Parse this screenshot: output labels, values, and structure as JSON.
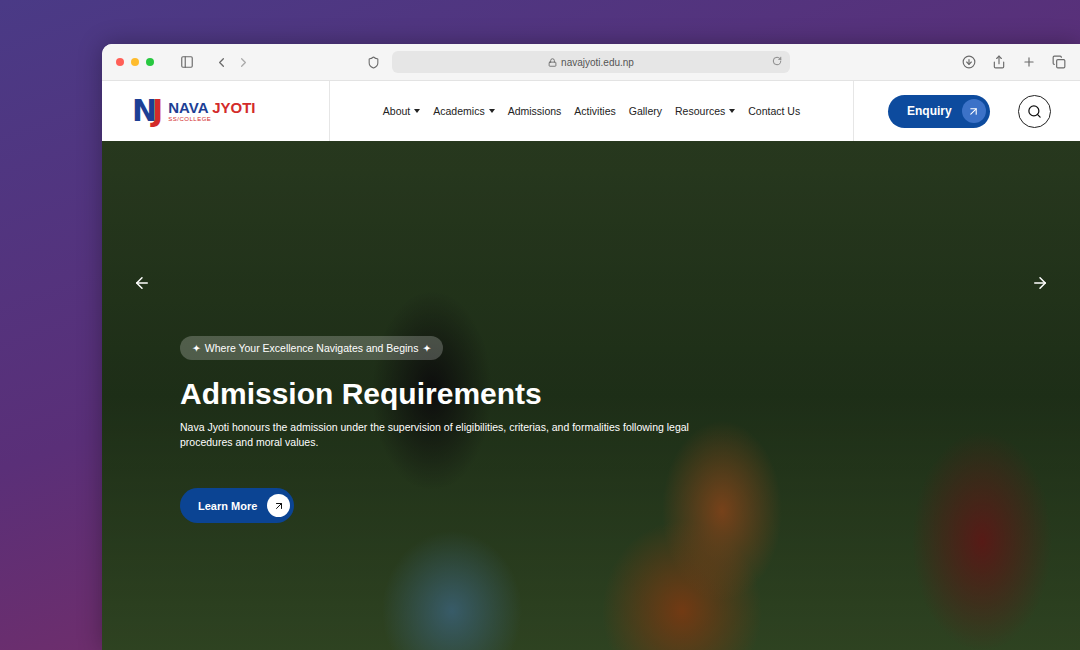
{
  "browser": {
    "url": "navajyoti.edu.np"
  },
  "logo": {
    "monogram": "NJ",
    "name_first": "NAVA",
    "name_second": "JYOTI",
    "subtitle": "SS/COLLEGE"
  },
  "nav": [
    {
      "label": "About",
      "dropdown": true
    },
    {
      "label": "Academics",
      "dropdown": true
    },
    {
      "label": "Admissions",
      "dropdown": false
    },
    {
      "label": "Activities",
      "dropdown": false
    },
    {
      "label": "Gallery",
      "dropdown": false
    },
    {
      "label": "Resources",
      "dropdown": true
    },
    {
      "label": "Contact Us",
      "dropdown": false
    }
  ],
  "enquiry": {
    "label": "Enquiry"
  },
  "hero": {
    "badge_mark": "✦",
    "badge": "Where Your Excellence Navigates and Begins",
    "title": "Admission Requirements",
    "description": "Nava Jyoti honours the admission under the supervision of eligibilities, criterias, and formalities following legal procedures and moral values.",
    "button": "Learn More"
  }
}
